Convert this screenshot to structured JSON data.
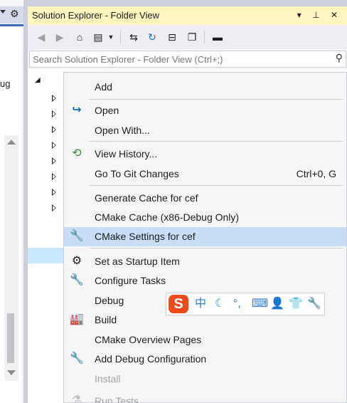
{
  "left_panel": {
    "gear_icon": "gear-icon",
    "truncated_text": "ug"
  },
  "explorer": {
    "title": "Solution Explorer - Folder View",
    "title_buttons": "▾ ⊥ ✕",
    "search_placeholder": "Search Solution Explorer - Folder View (Ctrl+;)",
    "toolbar_icons": [
      "back-icon",
      "forward-icon",
      "home-icon",
      "switch-view-icon",
      "sync-icon",
      "refresh-icon",
      "collapse-icon",
      "copy-icon",
      "minus-icon"
    ]
  },
  "menu": {
    "items": [
      {
        "label": "Add",
        "icon": "",
        "shortcut": ""
      },
      {
        "label": "Open",
        "icon": "↪",
        "shortcut": ""
      },
      {
        "label": "Open With...",
        "icon": "",
        "shortcut": ""
      },
      {
        "label": "View History...",
        "icon": "⟲",
        "shortcut": ""
      },
      {
        "label": "Go To Git Changes",
        "icon": "",
        "shortcut": "Ctrl+0, G"
      },
      {
        "label": "Generate Cache for cef",
        "icon": "",
        "shortcut": ""
      },
      {
        "label": "CMake Cache (x86-Debug Only)",
        "icon": "",
        "shortcut": ""
      },
      {
        "label": "CMake Settings for cef",
        "icon": "wrench",
        "shortcut": ""
      },
      {
        "label": "Set as Startup Item",
        "icon": "gear",
        "shortcut": ""
      },
      {
        "label": "Configure Tasks",
        "icon": "wrench",
        "shortcut": ""
      },
      {
        "label": "Debug",
        "icon": "",
        "shortcut": ""
      },
      {
        "label": "Build",
        "icon": "build",
        "shortcut": ""
      },
      {
        "label": "CMake Overview Pages",
        "icon": "",
        "shortcut": ""
      },
      {
        "label": "Add Debug Configuration",
        "icon": "wrench",
        "shortcut": ""
      },
      {
        "label": "Install",
        "icon": "",
        "shortcut": ""
      },
      {
        "label": "Run Tests",
        "icon": "",
        "shortcut": ""
      }
    ]
  },
  "ime": {
    "logo": "S",
    "chars": [
      "中",
      "☾",
      "°,",
      "⌨",
      "👤",
      "👕",
      "🔧"
    ]
  },
  "colors": {
    "title_bg": "#fdf4bf",
    "highlight": "#c9def5",
    "ime_logo": "#ee4a1b",
    "accent_blue": "#2a7de1"
  }
}
